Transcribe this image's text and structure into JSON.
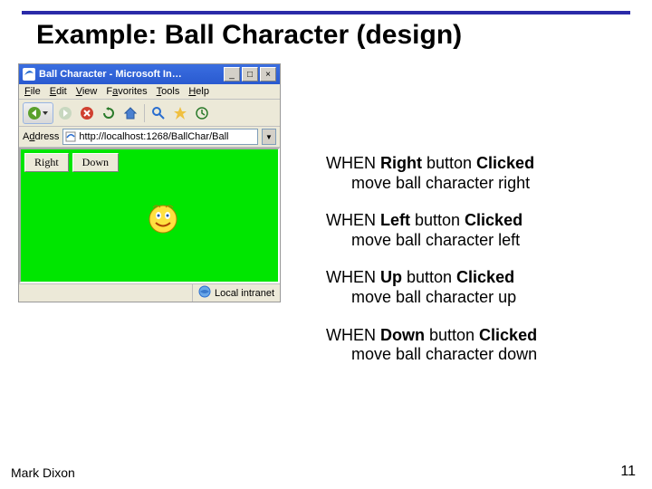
{
  "slide": {
    "title": "Example: Ball Character (design)",
    "author": "Mark Dixon",
    "page": "11"
  },
  "browser": {
    "title": "Ball Character - Microsoft In…",
    "menu": {
      "file": "File",
      "edit": "Edit",
      "view": "View",
      "favorites": "Favorites",
      "tools": "Tools",
      "help": "Help"
    },
    "address_label": "Address",
    "url": "http://localhost:1268/BallChar/Ball",
    "buttons": {
      "right": "Right",
      "down": "Down"
    },
    "status": "Local intranet",
    "winbtns": {
      "min": "_",
      "max": "□",
      "close": "×"
    },
    "dropdown_glyph": "▼"
  },
  "pseudo": [
    {
      "when": "WHEN ",
      "target": "Right",
      "tail": " button ",
      "event": "Clicked",
      "action": "move ball character right"
    },
    {
      "when": "WHEN ",
      "target": "Left",
      "tail": " button ",
      "event": "Clicked",
      "action": "move ball character left"
    },
    {
      "when": "WHEN ",
      "target": "Up",
      "tail": " button ",
      "event": "Clicked",
      "action": "move ball character up"
    },
    {
      "when": "WHEN ",
      "target": "Down",
      "tail": " button ",
      "event": "Clicked",
      "action": "move ball character down"
    }
  ]
}
